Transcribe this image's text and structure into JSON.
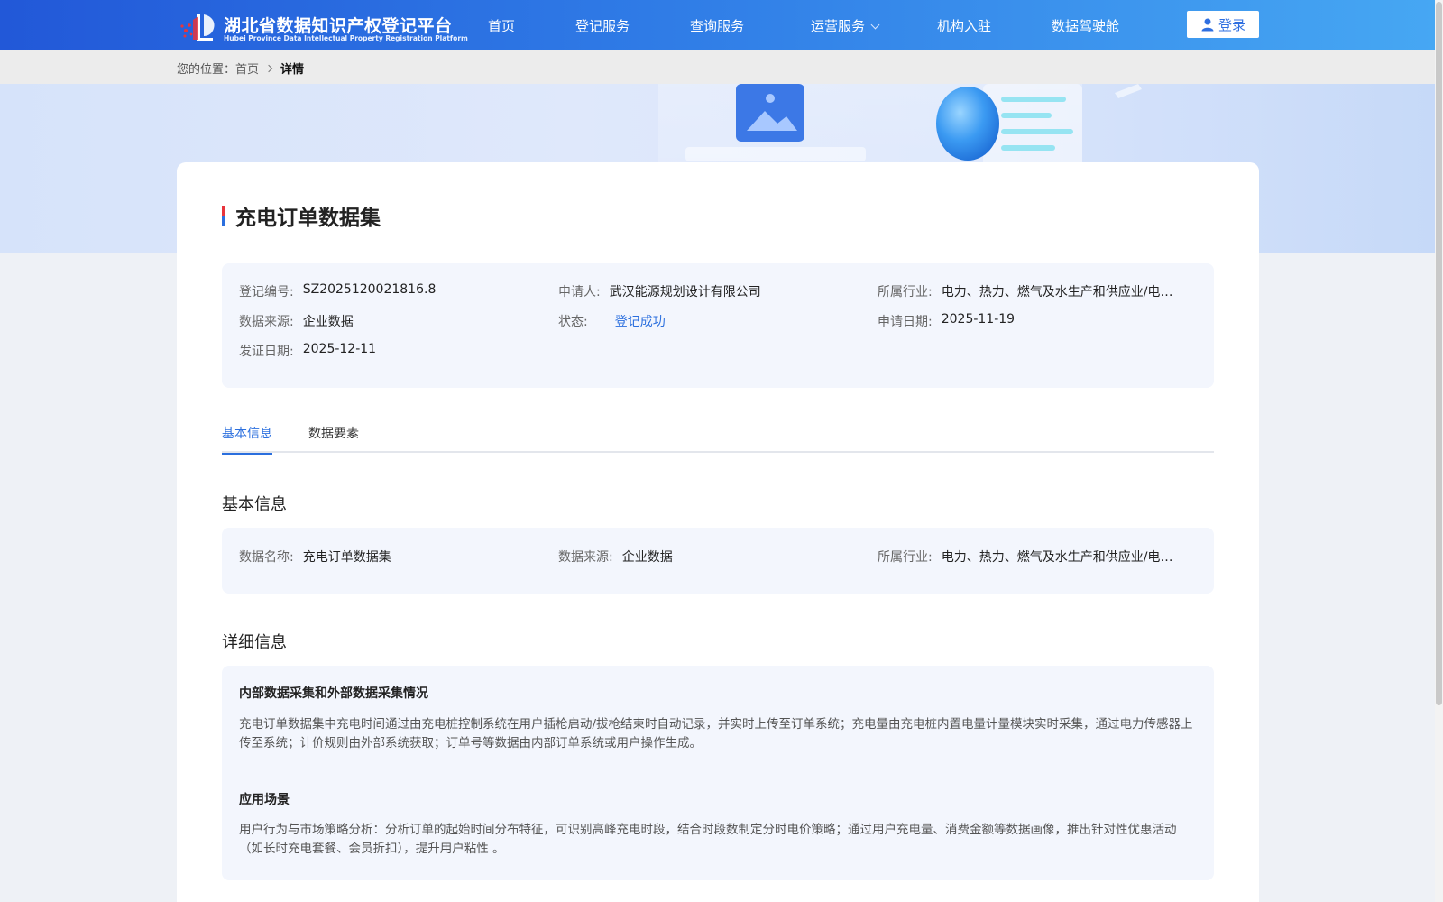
{
  "header": {
    "logo_cn": "湖北省数据知识产权登记平台",
    "logo_en": "Hubei Province Data Intellectual Property Registration Platform",
    "nav": [
      {
        "label": "首页"
      },
      {
        "label": "登记服务"
      },
      {
        "label": "查询服务"
      },
      {
        "label": "运营服务"
      },
      {
        "label": "机构入驻"
      },
      {
        "label": "数据驾驶舱"
      }
    ],
    "login_label": "登录",
    "colors": {
      "start": "#2258d8",
      "end": "#46a7f3"
    }
  },
  "breadcrumb": {
    "prefix": "您的位置：",
    "home": "首页",
    "current": "详情"
  },
  "detail": {
    "title": "充电订单数据集",
    "info": {
      "reg_no": {
        "label": "登记编号:",
        "value": "SZ2025120021816.8"
      },
      "applicant": {
        "label": "申请人:",
        "value": "武汉能源规划设计有限公司"
      },
      "industry": {
        "label": "所属行业:",
        "value": "电力、热力、燃气及水生产和供应业/电力..."
      },
      "source": {
        "label": "数据来源:",
        "value": "企业数据"
      },
      "status": {
        "label": "状态:",
        "value": "登记成功"
      },
      "apply_date": {
        "label": "申请日期:",
        "value": "2025-11-19"
      },
      "issue_date": {
        "label": "发证日期:",
        "value": "2025-12-11"
      }
    },
    "tabs": [
      {
        "label": "基本信息",
        "active": true
      },
      {
        "label": "数据要素",
        "active": false
      }
    ],
    "basic": {
      "section_title": "基本信息",
      "name": {
        "label": "数据名称:",
        "value": "充电订单数据集"
      },
      "source": {
        "label": "数据来源:",
        "value": "企业数据"
      },
      "industry": {
        "label": "所属行业:",
        "value": "电力、热力、燃气及水生产和供应业/电力..."
      }
    },
    "details": {
      "section_title": "详细信息",
      "collect_title": "内部数据采集和外部数据采集情况",
      "collect_text": "充电订单数据集中充电时间通过由充电桩控制系统在用户插枪启动/拔枪结束时自动记录，并实时上传至订单系统；充电量由充电桩内置电量计量模块实时采集，通过电力传感器上传至系统；计价规则由外部系统获取；订单号等数据由内部订单系统或用户操作生成。",
      "scene_title": "应用场景",
      "scene_text": "用户行为与市场策略分析：分析订单的起始时间分布特征，可识别高峰充电时段，结合时段数制定分时电价策略；通过用户充电量、消费金额等数据画像，推出针对性优惠活动（如长时充电套餐、会员折扣），提升用户粘性 。"
    },
    "accent_color": "#2b6fde"
  }
}
